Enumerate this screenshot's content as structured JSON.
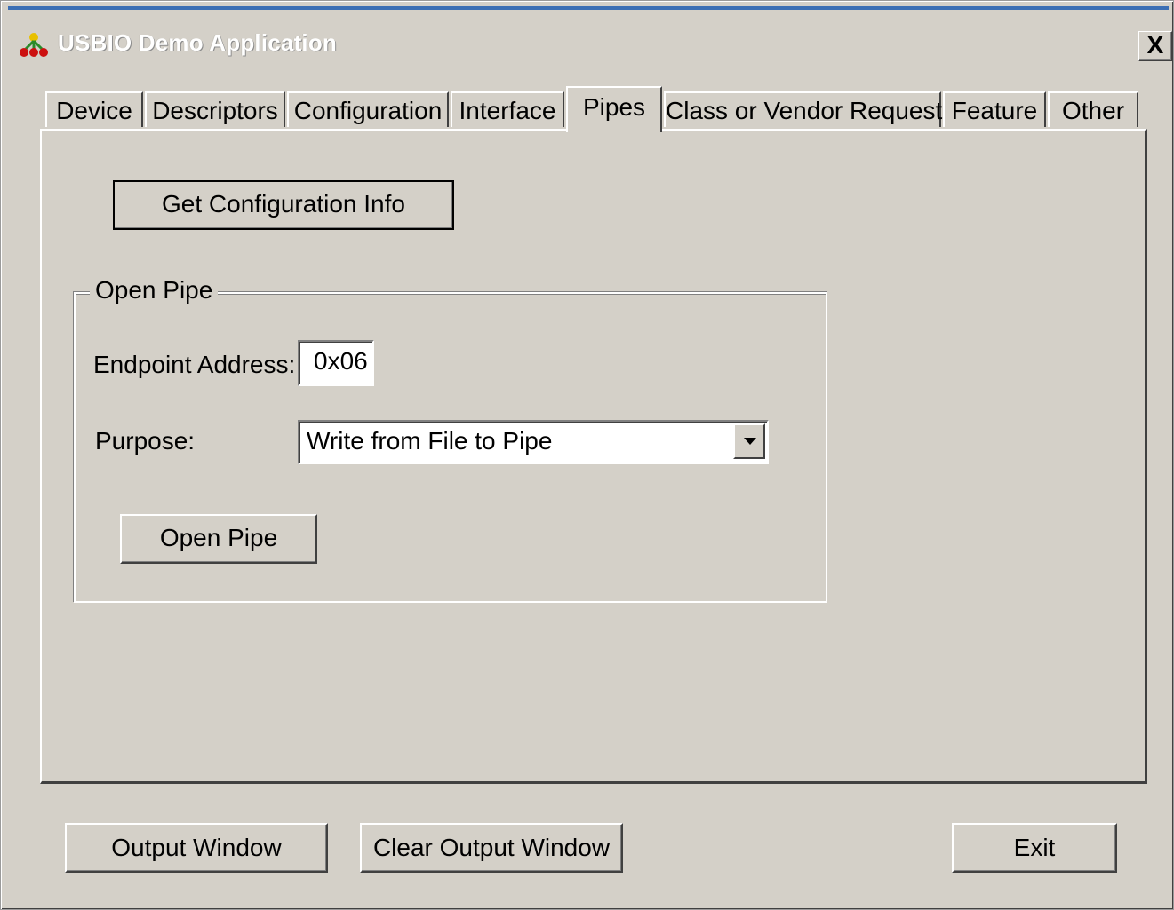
{
  "window": {
    "title": "USBIO Demo Application",
    "close_glyph": "X"
  },
  "tabs": [
    {
      "label": "Device"
    },
    {
      "label": "Descriptors"
    },
    {
      "label": "Configuration"
    },
    {
      "label": "Interface"
    },
    {
      "label": "Pipes",
      "active": true
    },
    {
      "label": "Class or Vendor Request"
    },
    {
      "label": "Feature"
    },
    {
      "label": "Other"
    }
  ],
  "pipes": {
    "get_config_button": "Get Configuration Info",
    "open_pipe_group": {
      "title": "Open Pipe",
      "endpoint_label": "Endpoint Address:",
      "endpoint_value": "0x06",
      "purpose_label": "Purpose:",
      "purpose_value": "Write from File to Pipe",
      "open_button": "Open Pipe"
    }
  },
  "footer": {
    "output_window": "Output Window",
    "clear_output_window": "Clear Output Window",
    "exit": "Exit"
  },
  "icons": {
    "app_icon": "usb-network-icon",
    "combo_arrow": "chevron-down-icon"
  }
}
